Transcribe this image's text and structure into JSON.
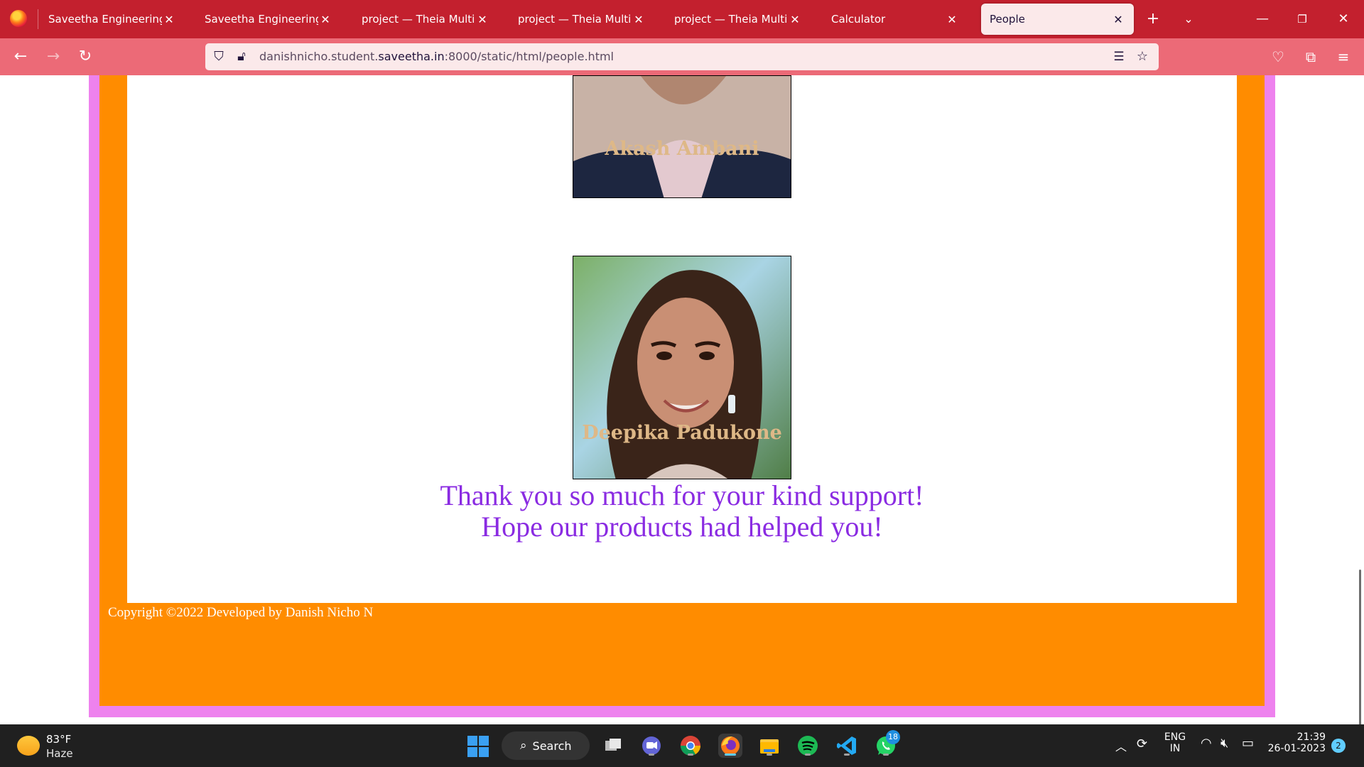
{
  "browser": {
    "tabs": [
      {
        "title": "Saveetha Engineering Colle"
      },
      {
        "title": "Saveetha Engineering Colle"
      },
      {
        "title": "project — Theia Multi-Lang"
      },
      {
        "title": "project — Theia Multi-Lang"
      },
      {
        "title": "project — Theia Multi-Lang"
      },
      {
        "title": "Calculator"
      },
      {
        "title": "People",
        "active": true
      }
    ],
    "url_prefix": "danishnicho.student.",
    "url_domain": "saveetha.in",
    "url_suffix": ":8000/static/html/people.html",
    "icons": {
      "logo": "firefox-logo-icon",
      "new_tab": "plus-icon",
      "list_tabs": "chevron-down-icon",
      "back": "back-arrow-icon",
      "forward": "forward-arrow-icon",
      "reload": "reload-icon",
      "tracking": "shield-icon",
      "insecure": "lock-strikethrough-icon",
      "reader": "reader-view-icon",
      "bookmark": "star-icon",
      "pocket": "pocket-icon",
      "extensions": "puzzle-icon",
      "menu": "hamburger-menu-icon"
    },
    "colors": {
      "tabbar": "#c3202e",
      "navbar": "#ec6a77",
      "urlbar": "#fbe9ea"
    }
  },
  "page": {
    "people": [
      {
        "name": "Akash Ambani"
      },
      {
        "name": "Deepika Padukone"
      }
    ],
    "thanks_line1": "Thank you so much for your kind support!",
    "thanks_line2": "Hope our products had helped you!",
    "copyright": "Copyright ©2022 Developed by Danish Nicho N",
    "colors": {
      "outer_border": "#ee82ee",
      "inner_border": "#ff8c00",
      "name": "#deb887",
      "thanks": "#8a2be2",
      "copyright": "#ffffff"
    }
  },
  "taskbar": {
    "weather_temp": "83°F",
    "weather_desc": "Haze",
    "search_label": "Search",
    "whatsapp_badge": "18",
    "lang_line1": "ENG",
    "lang_line2": "IN",
    "time": "21:39",
    "date": "26-01-2023",
    "notifications": "2",
    "apps": [
      "task-view",
      "teams-chat",
      "chrome",
      "firefox",
      "file-explorer",
      "spotify",
      "vscode",
      "whatsapp"
    ]
  }
}
